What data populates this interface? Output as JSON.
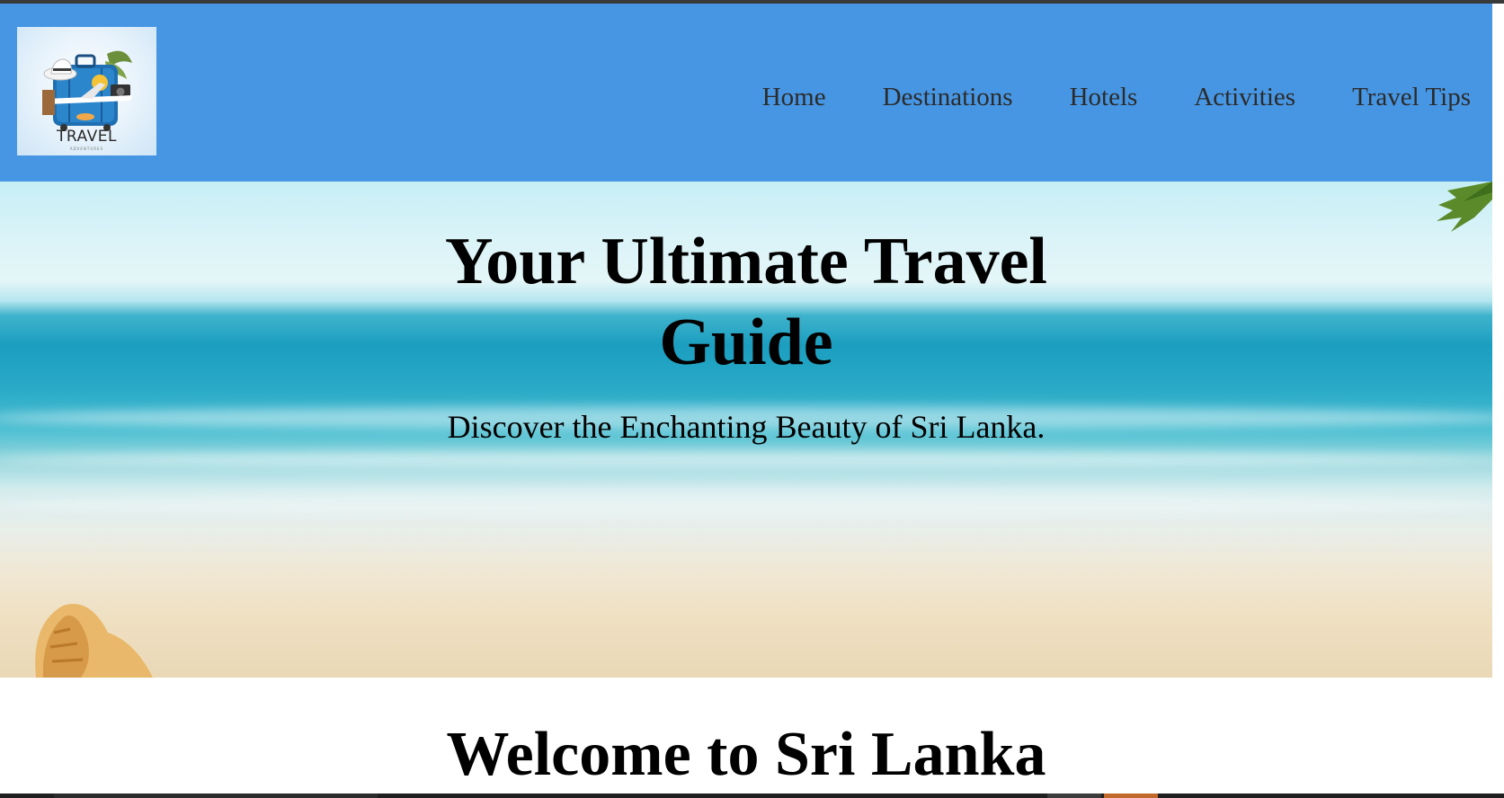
{
  "header": {
    "logo": {
      "text": "TRAVEL",
      "subtext": "ADVENTURES"
    },
    "nav": [
      {
        "label": "Home"
      },
      {
        "label": "Destinations"
      },
      {
        "label": "Hotels"
      },
      {
        "label": "Activities"
      },
      {
        "label": "Travel Tips"
      }
    ],
    "background_color": "#4796e3"
  },
  "hero": {
    "title_line1": "Your Ultimate Travel",
    "title_line2": "Guide",
    "subtitle": "Discover the Enchanting Beauty of Sri Lanka.",
    "background": "beach-ocean-image"
  },
  "main": {
    "welcome_heading": "Welcome to Sri Lanka"
  }
}
